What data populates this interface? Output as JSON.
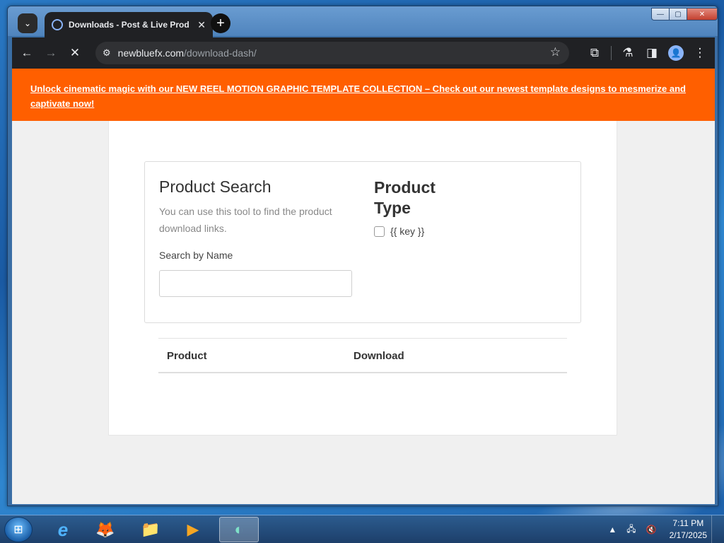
{
  "browser": {
    "tab": {
      "title": "Downloads - Post & Live Produ",
      "close_glyph": "✕"
    },
    "new_tab_glyph": "+",
    "tab_search_glyph": "⌄",
    "window_controls": {
      "minimize": "—",
      "maximize": "▢",
      "close": "✕"
    },
    "toolbar": {
      "back_glyph": "←",
      "forward_glyph": "→",
      "stop_glyph": "✕",
      "site_info_glyph": "⚙",
      "url_host": "newbluefx.com",
      "url_path": "/download-dash/",
      "bookmark_glyph": "☆",
      "extensions_glyph": "⧉",
      "labs_glyph": "⚗",
      "sidepanel_glyph": "◨",
      "profile_glyph": "👤",
      "menu_glyph": "⋮"
    }
  },
  "banner": {
    "text": "Unlock cinematic magic with our NEW REEL MOTION GRAPHIC TEMPLATE COLLECTION – Check out our newest template designs to mesmerize and captivate now!",
    "color": "#ff5f00"
  },
  "product_search": {
    "title": "Product Search",
    "description": "You can use this tool to find the product download links.",
    "search_label": "Search by Name",
    "search_value": "",
    "search_placeholder": ""
  },
  "product_type": {
    "title": "Product Type",
    "option_label": "{{ key }}",
    "option_checked": false
  },
  "results_table": {
    "columns": [
      "Product",
      "Download"
    ]
  },
  "taskbar": {
    "start_glyph": "⊞",
    "apps": [
      {
        "name": "internet-explorer",
        "glyph": "e"
      },
      {
        "name": "firefox",
        "glyph": "🦊"
      },
      {
        "name": "file-explorer",
        "glyph": "📁"
      },
      {
        "name": "media-player",
        "glyph": "▶"
      },
      {
        "name": "active-app",
        "glyph": "◐"
      }
    ],
    "tray": {
      "arrow_glyph": "▲",
      "network_glyph": "🖧",
      "volume_glyph": "🔇",
      "time": "7:11 PM",
      "date": "2/17/2025"
    }
  }
}
